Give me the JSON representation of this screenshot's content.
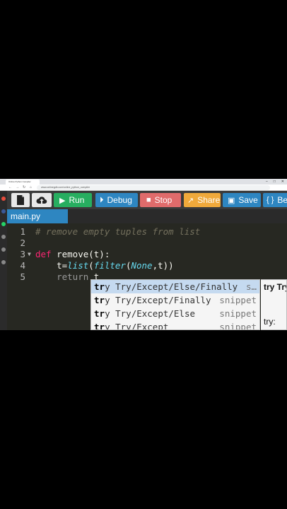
{
  "browser": {
    "tab_title": "Online Python Compiler",
    "url": "www.onlinegdb.com/online_python_compiler"
  },
  "toolbar": {
    "run_label": "Run",
    "debug_label": "Debug",
    "stop_label": "Stop",
    "share_label": "Share",
    "save_label": "Save",
    "beautify_label": "Be"
  },
  "file_tab": {
    "name": "main.py"
  },
  "editor": {
    "line_numbers": [
      "1",
      "2",
      "3",
      "4",
      "5"
    ],
    "lines": {
      "l1_comment": "# remove empty tuples from list",
      "l3_def": "def",
      "l3_rest": " remove(t):",
      "l4_indent": "    t=",
      "l4_list": "list",
      "l4_paren": "(",
      "l4_filter": "filter",
      "l4_paren2": "(",
      "l4_none": "None",
      "l4_end": ",t))",
      "l5_indent": "    ",
      "l5_return": "return",
      "l5_rest": " t"
    }
  },
  "autocomplete": {
    "items": [
      {
        "prefix": "tr",
        "rest": "y Try/Except/Else/Finally",
        "meta": "s…"
      },
      {
        "prefix": "tr",
        "rest": "y Try/Except/Finally",
        "meta": "snippet"
      },
      {
        "prefix": "tr",
        "rest": "y Try/Except/Else",
        "meta": "snippet"
      },
      {
        "prefix": "tr",
        "rest": "y Try/Except",
        "meta": "snippet"
      }
    ],
    "doc_title": "try Try",
    "doc_body": "try:"
  }
}
